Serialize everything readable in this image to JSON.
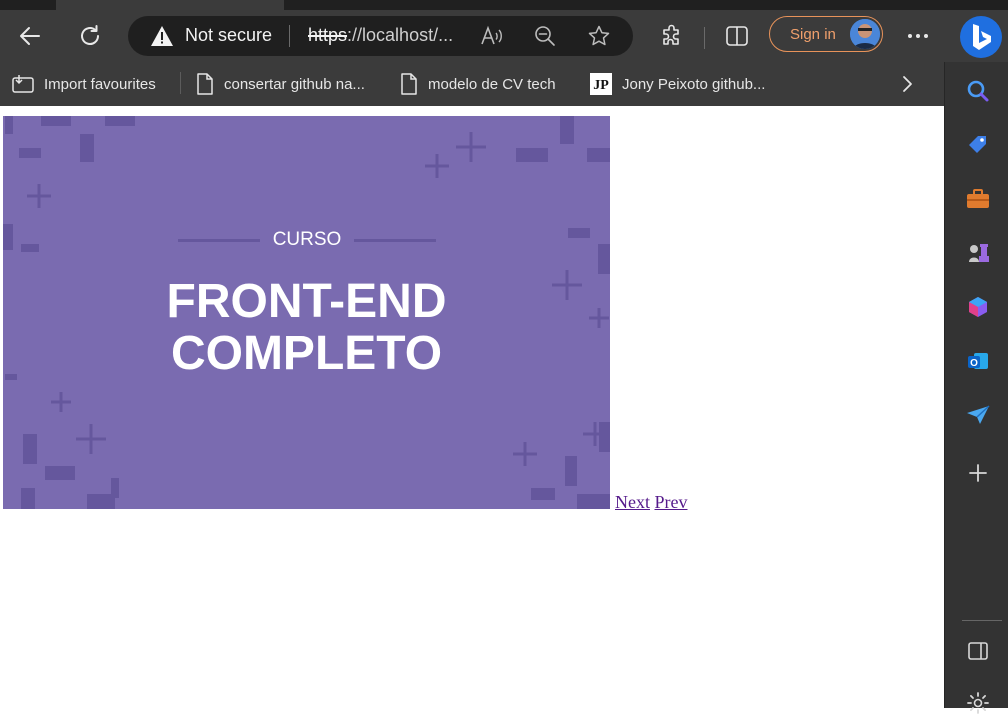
{
  "browser": {
    "omnibox": {
      "security_label": "Not secure",
      "url_scheme": "https",
      "url_rest": "://localhost/..."
    },
    "signin_label": "Sign in",
    "favourites": [
      {
        "label": "Import favourites",
        "icon": "import-icon"
      },
      {
        "label": "consertar github na...",
        "icon": "page-icon"
      },
      {
        "label": "modelo de CV tech",
        "icon": "page-icon"
      },
      {
        "label": "Jony Peixoto github...",
        "icon": "jp-logo-icon",
        "logo_text": "JP"
      }
    ],
    "colors": {
      "accent_signin": "#e8935a",
      "bing": "#1f6fe0"
    }
  },
  "page": {
    "banner": {
      "kicker": "CURSO",
      "title_line1": "FRONT-END",
      "title_line2": "COMPLETO",
      "background": "#7a6bb0"
    },
    "pager": {
      "next_label": "Next",
      "prev_label": "Prev"
    }
  }
}
